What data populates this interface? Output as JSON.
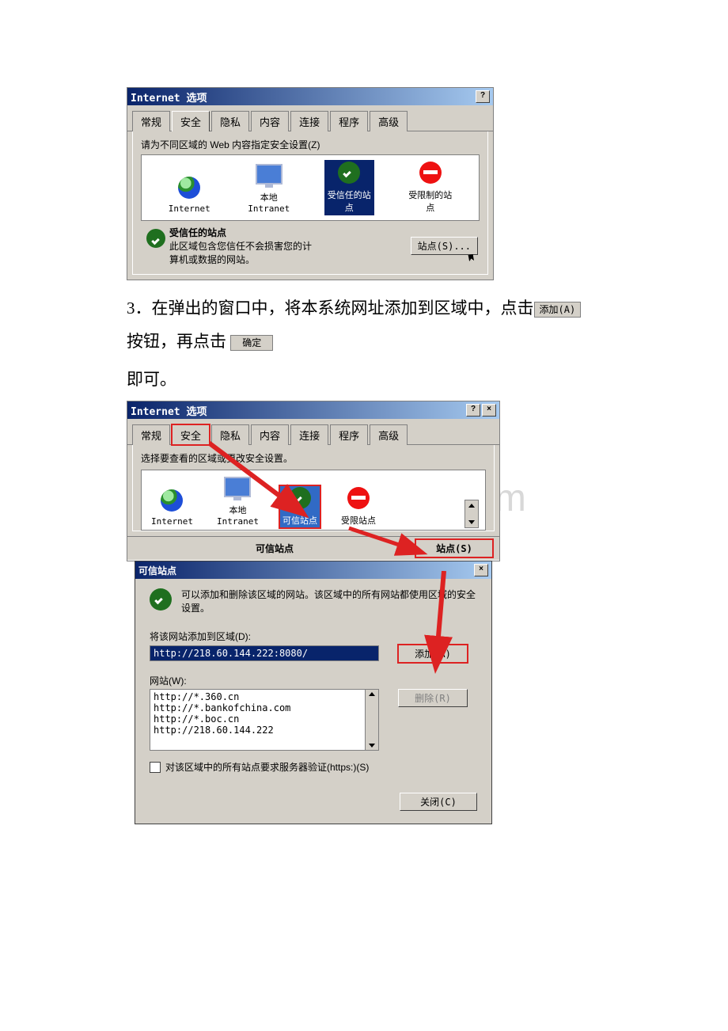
{
  "dialog1": {
    "title": "Internet 选项",
    "help_btn": "?",
    "tabs": [
      "常规",
      "安全",
      "隐私",
      "内容",
      "连接",
      "程序",
      "高级"
    ],
    "active_tab_index": 1,
    "prompt": "请为不同区域的 Web 内容指定安全设置(Z)",
    "zones": [
      {
        "label": "Internet"
      },
      {
        "label": "本地\nIntranet"
      },
      {
        "label": "受信任的站\n点",
        "selected": true
      },
      {
        "label": "受限制的站\n点"
      }
    ],
    "trusted": {
      "heading": "受信任的站点",
      "desc1": "此区域包含您信任不会损害您的计",
      "desc2": "算机或数据的网站。",
      "sites_btn": "站点(S)..."
    }
  },
  "paragraph": {
    "p1a": "3．在弹出的窗口中，将本系统网址添加到区域中，点击",
    "p1b_btn": "添加(A)",
    "p2a": "按钮，再点击",
    "p2b_btn": "确定",
    "p3": "即可。"
  },
  "dialog2": {
    "title": "Internet 选项",
    "tabs": [
      "常规",
      "安全",
      "隐私",
      "内容",
      "连接",
      "程序",
      "高级"
    ],
    "active_tab_index": 1,
    "prompt": "选择要查看的区域或更改安全设置。",
    "zones": [
      {
        "label": "Internet"
      },
      {
        "label": "本地\nIntranet"
      },
      {
        "label": "可信站点",
        "selected": true
      },
      {
        "label": "受限站点"
      }
    ],
    "groove_label": "可信站点",
    "sites_btn": "站点(S)"
  },
  "subdialog": {
    "title": "可信站点",
    "close_btn": "×",
    "desc": "可以添加和删除该区域的网站。该区域中的所有网站都使用区域的安全设置。",
    "add_label": "将该网站添加到区域(D):",
    "add_value": "http://218.60.144.222:8080/",
    "add_btn": "添加(A)",
    "list_label": "网站(W):",
    "list_items": [
      "http://*.360.cn",
      "http://*.bankofchina.com",
      "http://*.boc.cn",
      "http://218.60.144.222"
    ],
    "remove_btn": "删除(R)",
    "https_check": "对该区域中的所有站点要求服务器验证(https:)(S)",
    "close2_btn": "关闭(C)"
  },
  "watermark": "www.bingdoc.com"
}
